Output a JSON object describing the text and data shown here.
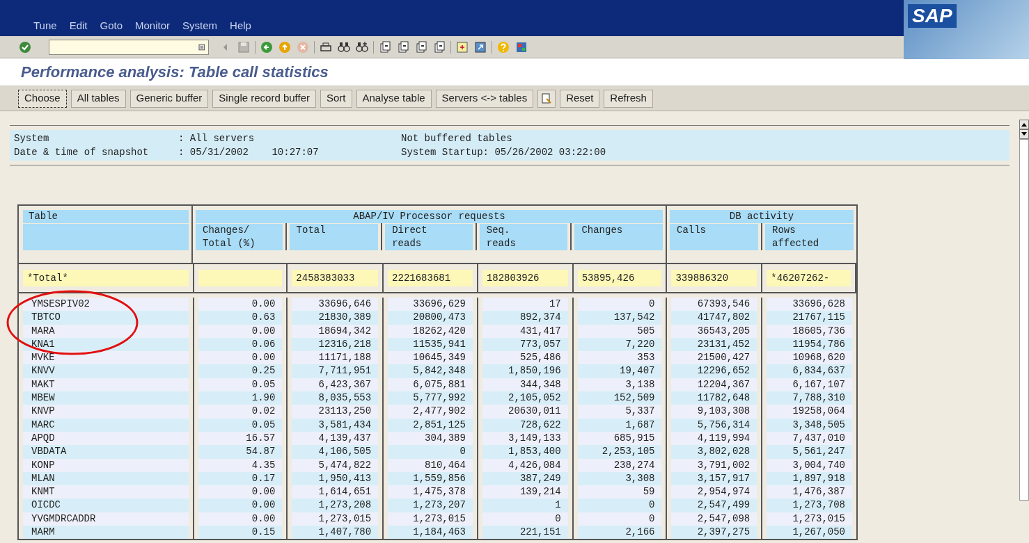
{
  "menu": [
    "Tune",
    "Edit",
    "Goto",
    "Monitor",
    "System",
    "Help"
  ],
  "title": "Performance analysis: Table call statistics",
  "app_toolbar": [
    {
      "kind": "text",
      "label": "Choose",
      "focused": true
    },
    {
      "kind": "text",
      "label": "All tables",
      "focused": false
    },
    {
      "kind": "text",
      "label": "Generic buffer",
      "focused": false
    },
    {
      "kind": "text",
      "label": "Single record buffer",
      "focused": false
    },
    {
      "kind": "text",
      "label": "Sort",
      "focused": false
    },
    {
      "kind": "text",
      "label": "Analyse table",
      "focused": false
    },
    {
      "kind": "text",
      "label": "Servers <-> tables",
      "focused": false
    },
    {
      "kind": "icon",
      "focused": false
    },
    {
      "kind": "text",
      "label": "Reset",
      "focused": false
    },
    {
      "kind": "text",
      "label": "Refresh",
      "focused": false
    }
  ],
  "info": {
    "lines": [
      {
        "label": "System",
        "value": ": All servers",
        "right": "Not buffered tables"
      },
      {
        "label": "Date & time of snapshot",
        "value": ": 05/31/2002    10:27:07",
        "right": "System Startup: 05/26/2002 03:22:00"
      }
    ]
  },
  "table": {
    "groups": [
      "Table",
      "ABAP/IV Processor requests",
      "DB activity"
    ],
    "columns": [
      "Changes/ Total (%)",
      "Total",
      "Direct reads",
      "Seq. reads",
      "Changes",
      "Calls",
      "Rows affected"
    ],
    "total_row": {
      "label": "*Total*",
      "values": [
        "2458383033",
        "2221683681",
        "182803926",
        "53895,426",
        "339886320",
        "*46207262-"
      ]
    },
    "rows": [
      [
        "YMSESPIV02",
        "0.00",
        "33696,646",
        "33696,629",
        "17",
        "0",
        "67393,546",
        "33696,628"
      ],
      [
        "TBTCO",
        "0.63",
        "21830,389",
        "20800,473",
        "892,374",
        "137,542",
        "41747,802",
        "21767,115"
      ],
      [
        "MARA",
        "0.00",
        "18694,342",
        "18262,420",
        "431,417",
        "505",
        "36543,205",
        "18605,736"
      ],
      [
        "KNA1",
        "0.06",
        "12316,218",
        "11535,941",
        "773,057",
        "7,220",
        "23131,452",
        "11954,786"
      ],
      [
        "MVKE",
        "0.00",
        "11171,188",
        "10645,349",
        "525,486",
        "353",
        "21500,427",
        "10968,620"
      ],
      [
        "KNVV",
        "0.25",
        "7,711,951",
        "5,842,348",
        "1,850,196",
        "19,407",
        "12296,652",
        "6,834,637"
      ],
      [
        "MAKT",
        "0.05",
        "6,423,367",
        "6,075,881",
        "344,348",
        "3,138",
        "12204,367",
        "6,167,107"
      ],
      [
        "MBEW",
        "1.90",
        "8,035,553",
        "5,777,992",
        "2,105,052",
        "152,509",
        "11782,648",
        "7,788,310"
      ],
      [
        "KNVP",
        "0.02",
        "23113,250",
        "2,477,902",
        "20630,011",
        "5,337",
        "9,103,308",
        "19258,064"
      ],
      [
        "MARC",
        "0.05",
        "3,581,434",
        "2,851,125",
        "728,622",
        "1,687",
        "5,756,314",
        "3,348,505"
      ],
      [
        "APQD",
        "16.57",
        "4,139,437",
        "304,389",
        "3,149,133",
        "685,915",
        "4,119,994",
        "7,437,010"
      ],
      [
        "VBDATA",
        "54.87",
        "4,106,505",
        "0",
        "1,853,400",
        "2,253,105",
        "3,802,028",
        "5,561,247"
      ],
      [
        "KONP",
        "4.35",
        "5,474,822",
        "810,464",
        "4,426,084",
        "238,274",
        "3,791,002",
        "3,004,740"
      ],
      [
        "MLAN",
        "0.17",
        "1,950,413",
        "1,559,856",
        "387,249",
        "3,308",
        "3,157,917",
        "1,897,918"
      ],
      [
        "KNMT",
        "0.00",
        "1,614,651",
        "1,475,378",
        "139,214",
        "59",
        "2,954,974",
        "1,476,387"
      ],
      [
        "OICDC",
        "0.00",
        "1,273,208",
        "1,273,207",
        "1",
        "0",
        "2,547,499",
        "1,273,708"
      ],
      [
        "YVGMDRCADDR",
        "0.00",
        "1,273,015",
        "1,273,015",
        "0",
        "0",
        "2,547,098",
        "1,273,015"
      ],
      [
        "MARM",
        "0.15",
        "1,407,780",
        "1,184,463",
        "221,151",
        "2,166",
        "2,397,275",
        "1,267,050"
      ]
    ]
  },
  "logo": "SAP"
}
